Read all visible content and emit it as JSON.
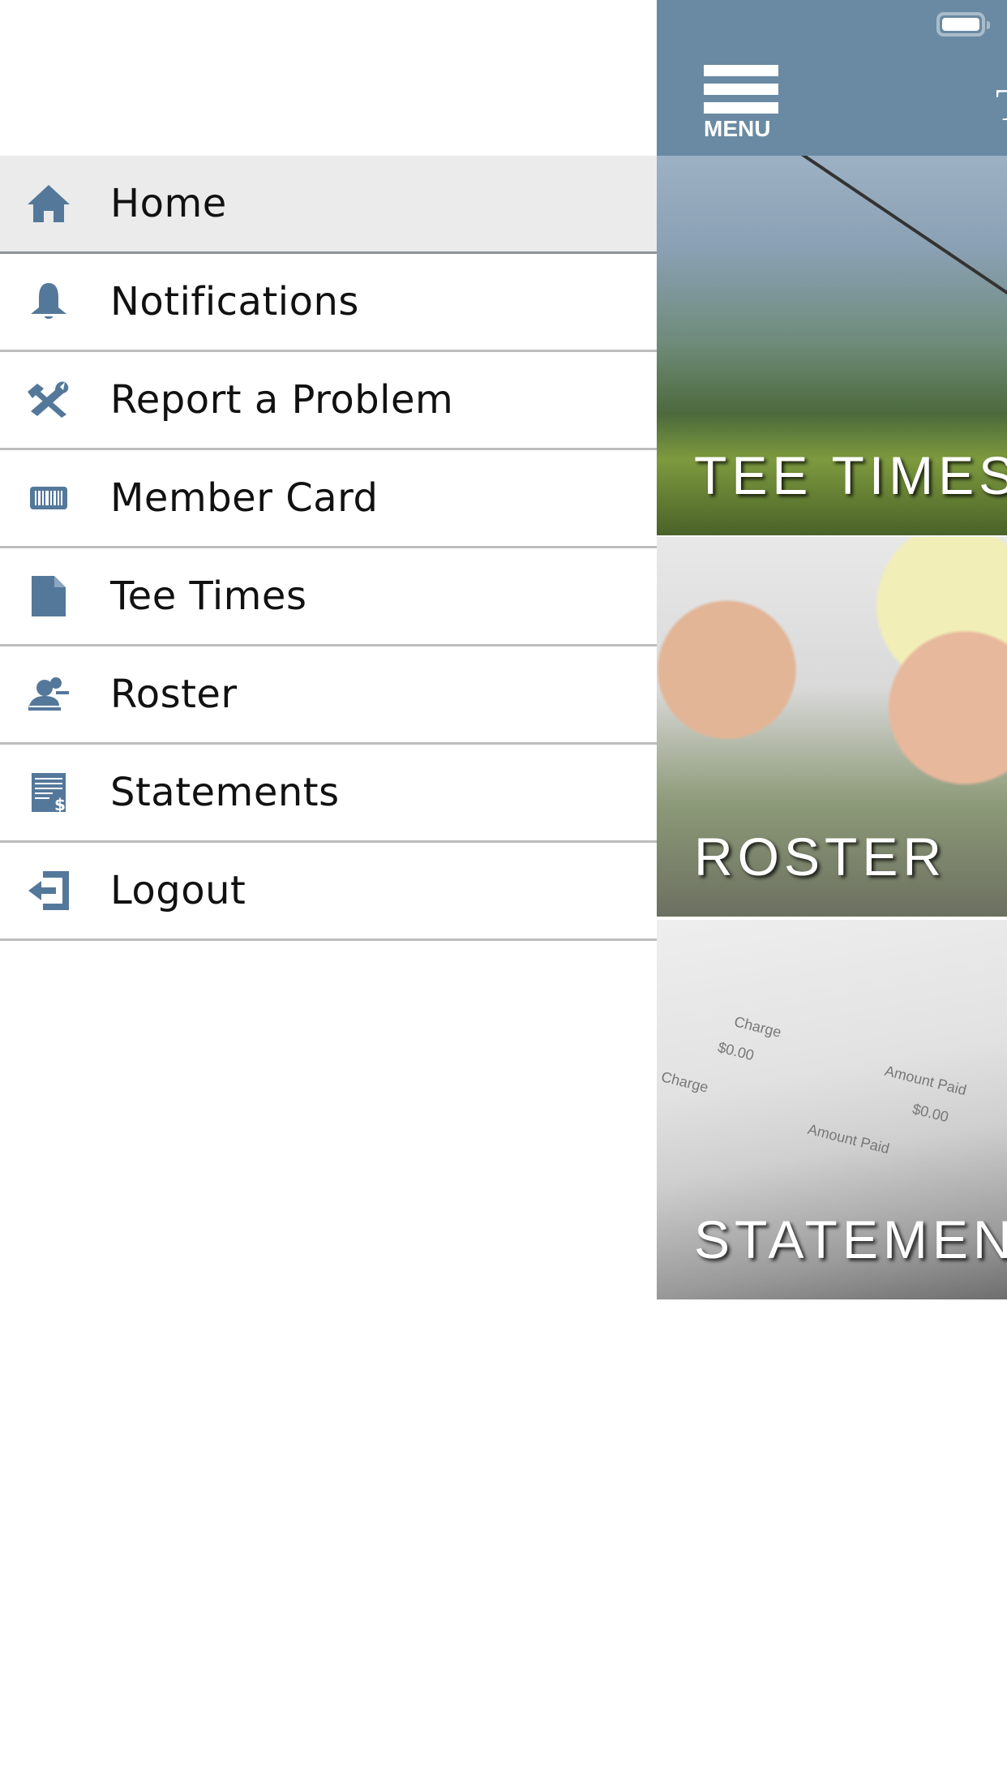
{
  "drawer": {
    "items": [
      {
        "label": "Home",
        "icon": "home-icon",
        "active": true
      },
      {
        "label": "Notifications",
        "icon": "bell-icon"
      },
      {
        "label": "Report a Problem",
        "icon": "tools-icon"
      },
      {
        "label": "Member Card",
        "icon": "barcode-card-icon"
      },
      {
        "label": "Tee Times",
        "icon": "document-icon"
      },
      {
        "label": "Roster",
        "icon": "person-icon"
      },
      {
        "label": "Statements",
        "icon": "statement-icon"
      },
      {
        "label": "Logout",
        "icon": "logout-icon"
      }
    ]
  },
  "header": {
    "menu_label": "MENU",
    "title_fragment": "T"
  },
  "tiles": [
    {
      "label": "TEE TIMES"
    },
    {
      "label": "ROSTER"
    },
    {
      "label": "STATEMENTS",
      "image_text": [
        "Charge",
        "$0.00",
        "Amount Paid",
        "$0.00",
        "Charge",
        "Amount Paid"
      ]
    }
  ],
  "colors": {
    "accent": "#6a8aa3",
    "icon": "#54789a",
    "active_row": "#ebebeb"
  }
}
